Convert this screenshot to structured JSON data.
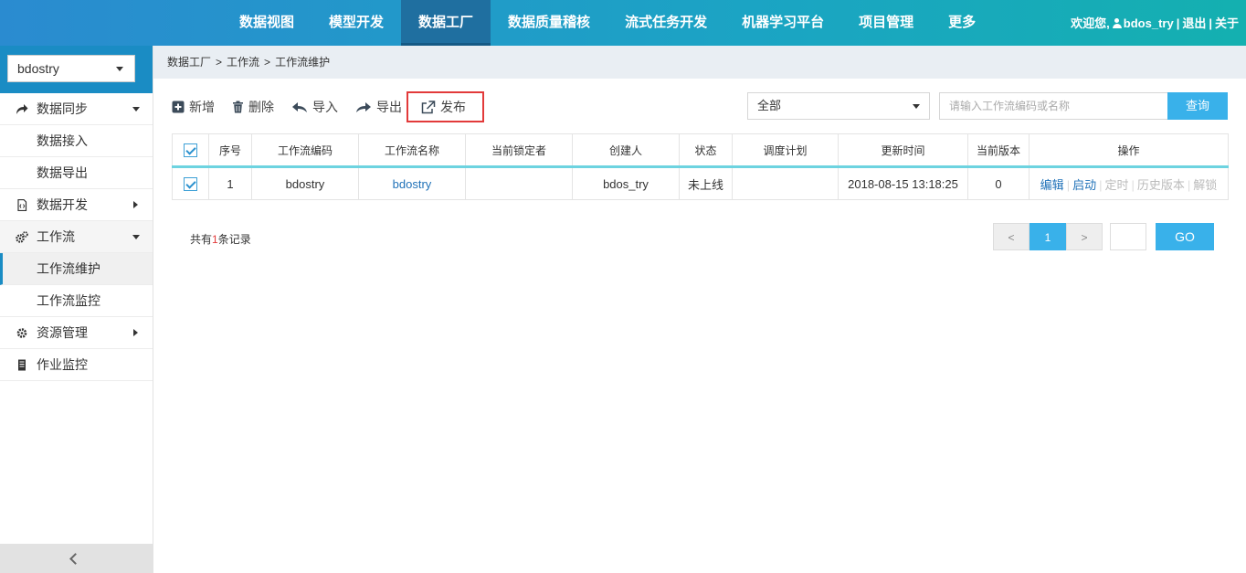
{
  "topnav": {
    "items": [
      {
        "label": "数据视图"
      },
      {
        "label": "模型开发"
      },
      {
        "label": "数据工厂"
      },
      {
        "label": "数据质量稽核"
      },
      {
        "label": "流式任务开发"
      },
      {
        "label": "机器学习平台"
      },
      {
        "label": "项目管理"
      },
      {
        "label": "更多"
      }
    ],
    "active_index": 2,
    "welcome": "欢迎您,",
    "username": "bdos_try",
    "logout": "退出",
    "about": "关于",
    "separator": "|"
  },
  "sidebar": {
    "project": "bdostry",
    "items": [
      {
        "label": "数据同步",
        "icon": "share-arrow-icon"
      },
      {
        "label": "数据接入"
      },
      {
        "label": "数据导出"
      },
      {
        "label": "数据开发",
        "icon": "code-file-icon"
      },
      {
        "label": "工作流",
        "icon": "gears-icon"
      },
      {
        "label": "工作流维护"
      },
      {
        "label": "工作流监控"
      },
      {
        "label": "资源管理",
        "icon": "gear-icon"
      },
      {
        "label": "作业监控",
        "icon": "document-icon"
      }
    ]
  },
  "breadcrumb": {
    "items": [
      "数据工厂",
      "工作流",
      "工作流维护"
    ],
    "separator": ">"
  },
  "toolbar": {
    "add": "新增",
    "delete": "删除",
    "import": "导入",
    "export": "导出",
    "publish": "发布"
  },
  "filter": {
    "selected": "全部"
  },
  "search": {
    "placeholder": "请输入工作流编码或名称",
    "button": "查询"
  },
  "table": {
    "headers": [
      "序号",
      "工作流编码",
      "工作流名称",
      "当前锁定者",
      "创建人",
      "状态",
      "调度计划",
      "更新时间",
      "当前版本",
      "操作"
    ],
    "rows": [
      {
        "index": "1",
        "code": "bdostry",
        "name": "bdostry",
        "locker": "",
        "creator": "bdos_try",
        "status": "未上线",
        "schedule": "",
        "updated": "2018-08-15 13:18:25",
        "version": "0",
        "actions": [
          "编辑",
          "启动",
          "定时",
          "历史版本",
          "解锁"
        ]
      }
    ]
  },
  "footer": {
    "total_prefix": "共有",
    "total_count": "1",
    "total_suffix": "条记录"
  },
  "pager": {
    "prev": "<",
    "current": "1",
    "next": ">",
    "go": "GO"
  },
  "colors": {
    "accent": "#39b1ea",
    "active_nav": "#1f6fa0",
    "highlight_box": "#e23a3a",
    "link": "#2273b9"
  }
}
